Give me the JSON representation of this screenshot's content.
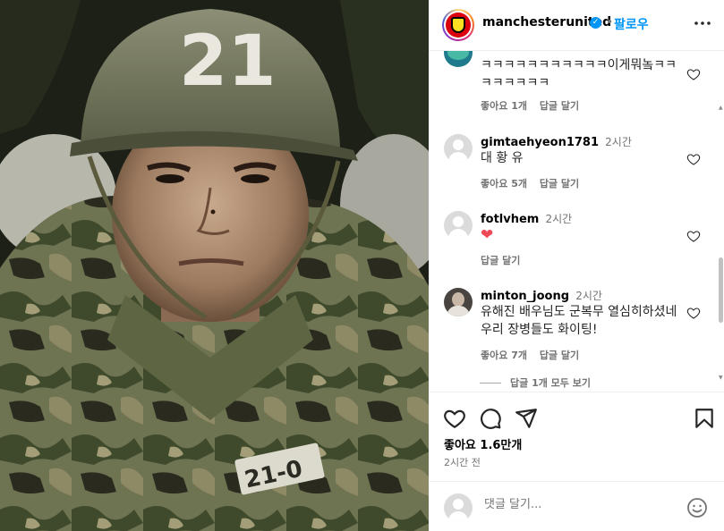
{
  "post_header": {
    "username": "manchesterunited",
    "verified_mark": "✓",
    "separator": "•",
    "follow_label": "팔로우",
    "more_icon": "more-horizontal-icon"
  },
  "photo": {
    "helmet_number": "21",
    "name_tag": "21-0"
  },
  "comments": [
    {
      "username": "",
      "time": "",
      "text": "ㅋㅋㅋㅋㅋㅋㅋㅋㅋㅋㅋ이게뭐놐ㅋㅋㅋㅋㅋㅋㅋㅋ",
      "likes": "좋아요 1개",
      "reply": "답글 달기"
    },
    {
      "username": "gimtaehyeon1781",
      "time": "2시간",
      "text": "대 황 유",
      "likes": "좋아요 5개",
      "reply": "답글 달기"
    },
    {
      "username": "fotlvhem",
      "time": "2시간",
      "text": "❤",
      "likes": "",
      "reply": "답글 달기"
    },
    {
      "username": "minton_joong",
      "time": "2시간",
      "text": "유해진 배우님도 군복무 열심히하셨네 우리 장병들도 화이팅!",
      "likes": "좋아요 7개",
      "reply": "답글 달기"
    }
  ],
  "view_replies": "답글 1개 모두 보기",
  "actions": {
    "like_icon": "heart-icon",
    "comment_icon": "comment-icon",
    "share_icon": "share-icon",
    "save_icon": "bookmark-icon"
  },
  "likes_count": "좋아요 1.6만개",
  "posted_ago": "2시간 전",
  "add_comment": {
    "placeholder": "댓글 달기...",
    "emoji_icon": "emoji-icon"
  },
  "colors": {
    "link_blue": "#0095f6",
    "heart_red": "#ed4956",
    "muted_text": "#737373"
  }
}
